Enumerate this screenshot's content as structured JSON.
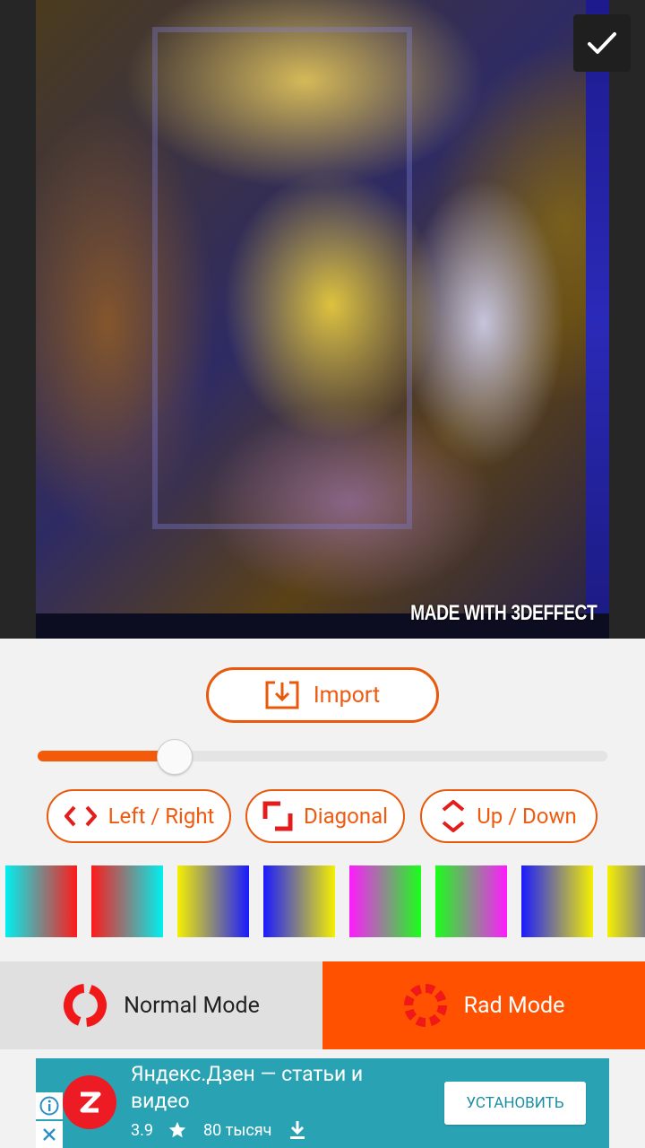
{
  "photo": {
    "watermark": "MADE WITH 3DEFFECT",
    "confirm_icon": "check-icon"
  },
  "controls": {
    "import_label": "Import",
    "import_icon": "import-icon",
    "slider_value": 0.24,
    "direction_buttons": [
      {
        "label": "Left / Right",
        "icon": "left-right-arrows-icon"
      },
      {
        "label": "Diagonal",
        "icon": "diagonal-corners-icon"
      },
      {
        "label": "Up / Down",
        "icon": "up-down-arrows-icon"
      }
    ],
    "color_swatches": [
      {
        "from": "#00f0f0",
        "to": "#ff1a1a"
      },
      {
        "from": "#ff1a1a",
        "to": "#00f0f0"
      },
      {
        "from": "#f5f000",
        "to": "#1a1aff"
      },
      {
        "from": "#1a1aff",
        "to": "#f5f000"
      },
      {
        "from": "#ff1aff",
        "to": "#1aff1a"
      },
      {
        "from": "#1aff1a",
        "to": "#ff1aff"
      },
      {
        "from": "#1a1aff",
        "to": "#f5f000"
      },
      {
        "from": "#f5f000",
        "to": "#1a1aff"
      }
    ],
    "accent_color": "#f05a0f"
  },
  "modes": {
    "normal_label": "Normal Mode",
    "rad_label": "Rad Mode",
    "active": "rad"
  },
  "ad": {
    "title": "Яндекс.Дзен — статьи и видео",
    "rating": "3.9",
    "downloads": "80 тысяч",
    "install_label": "УСТАНОВИТЬ",
    "bg_color": "#29a3b4"
  }
}
